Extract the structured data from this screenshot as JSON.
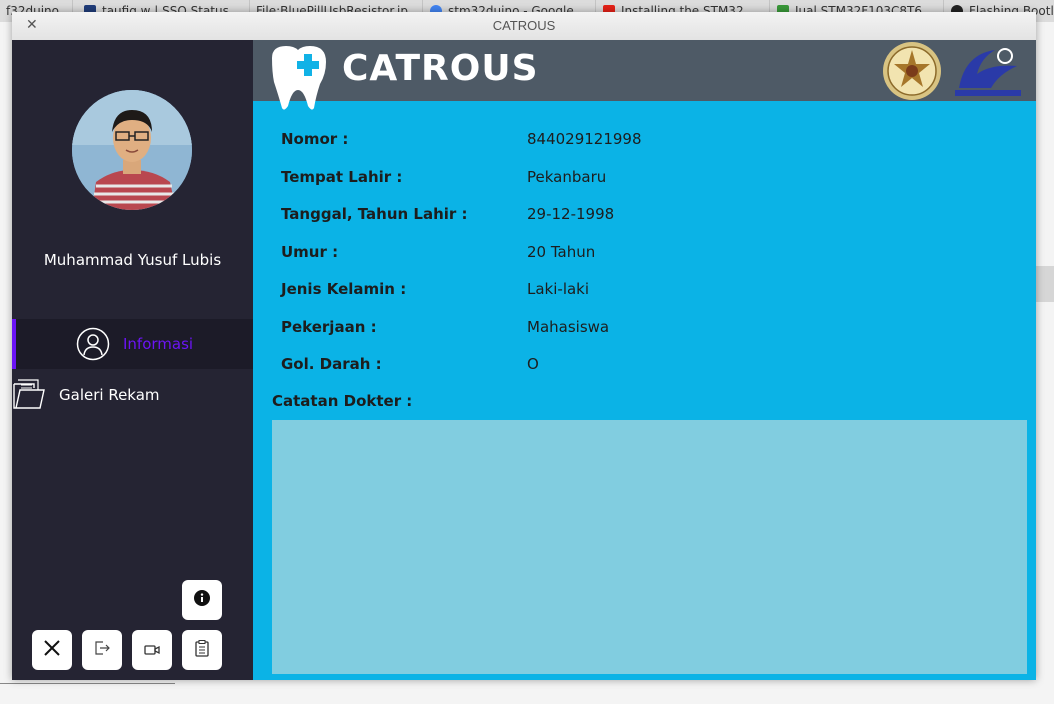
{
  "background_tabs": [
    {
      "label": "f32duino",
      "color": "#3b7dd8"
    },
    {
      "label": "taufiq.w | SSO Status",
      "color": "#1f3c7a"
    },
    {
      "label": "File:BluePillUsbResistor.jp",
      "color": "#888888"
    },
    {
      "label": "stm32duino - Google",
      "color": "#4285f4"
    },
    {
      "label": "Installing the STM32",
      "color": "#e62117"
    },
    {
      "label": "Jual STM32F103C8T6",
      "color": "#3a9a3a"
    },
    {
      "label": "Flashing Bootl",
      "color": "#222222"
    }
  ],
  "window": {
    "title": "CATROUS",
    "close_icon": "close-icon"
  },
  "sidebar": {
    "user_name": "Muhammad Yusuf Lubis",
    "nav": [
      {
        "label": "Informasi",
        "icon": "user-circle-icon",
        "active": true,
        "color": "#6b14f5"
      },
      {
        "label": "Galeri Rekam",
        "icon": "folder-icon",
        "active": false,
        "color": "#ffffff"
      }
    ],
    "buttons": {
      "info": "info-icon",
      "close": "close-icon",
      "logout": "logout-icon",
      "video": "video-camera-icon",
      "clipboard": "clipboard-icon"
    }
  },
  "header": {
    "app_name": "CATROUS",
    "color": "#4e5a66"
  },
  "patient": {
    "fields": [
      {
        "label": "Nomor :",
        "value": "844029121998"
      },
      {
        "label": "Tempat Lahir :",
        "value": "Pekanbaru"
      },
      {
        "label": "Tanggal, Tahun Lahir :",
        "value": "29-12-1998"
      },
      {
        "label": "Umur :",
        "value": "20 Tahun"
      },
      {
        "label": "Jenis Kelamin :",
        "value": "Laki-laki"
      },
      {
        "label": "Pekerjaan :",
        "value": "Mahasiswa"
      },
      {
        "label": "Gol. Darah :",
        "value": "O"
      }
    ],
    "notes_label": "Catatan Dokter :",
    "notes_value": ""
  },
  "colors": {
    "content_bg": "#0bb3e6",
    "sidebar_bg": "#252433",
    "notes_bg": "#81cde0",
    "accent": "#6b14f5"
  }
}
